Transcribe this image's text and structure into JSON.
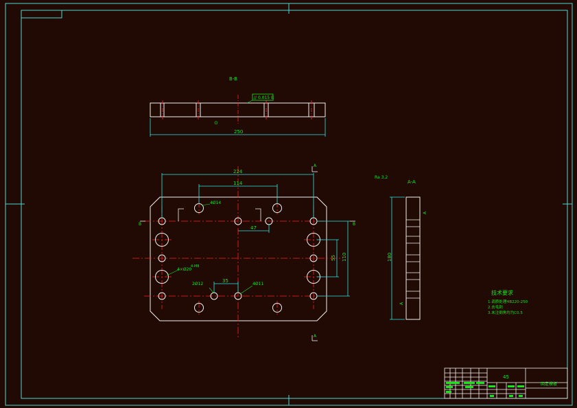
{
  "colors": {
    "background": "#210a03",
    "sheet_border": "#4fd6d6",
    "outline": "#f2f2f2",
    "dimension": "#2ee6e6",
    "centerline": "#ff2020",
    "annotation": "#19e619"
  },
  "section_bb": {
    "label": "B-B",
    "tolerance_frame": "// 0.015 B",
    "surface_mark": "⊙",
    "width_dim": "250"
  },
  "plan_view": {
    "dim_hole_span": "224",
    "dim_inner_span": "114",
    "dim_offset": "47",
    "dim_pitch": "35",
    "dim_v_small": "55",
    "dim_v_large": "110",
    "hole_label_top": "4Ø14",
    "hole_label_bottom_left": "2Ø12",
    "hole_label_bottom_right": "4Ø11",
    "hole_label_left": "4×Ø20",
    "hole_note_left": "4-M8",
    "section_marker_a": "A",
    "section_marker_b": "B"
  },
  "section_aa": {
    "label": "A-A",
    "height_dim": "180",
    "surface_mark": "Ra 3.2",
    "depth_mark": "A"
  },
  "technical_requirements": {
    "heading": "技术要求",
    "lines": [
      "1.调质处理HB220-250",
      "2.去毛刺",
      "3.未注倒角均为C0.5"
    ]
  },
  "title_block": {
    "material": "45",
    "part_name": "固定模板"
  }
}
